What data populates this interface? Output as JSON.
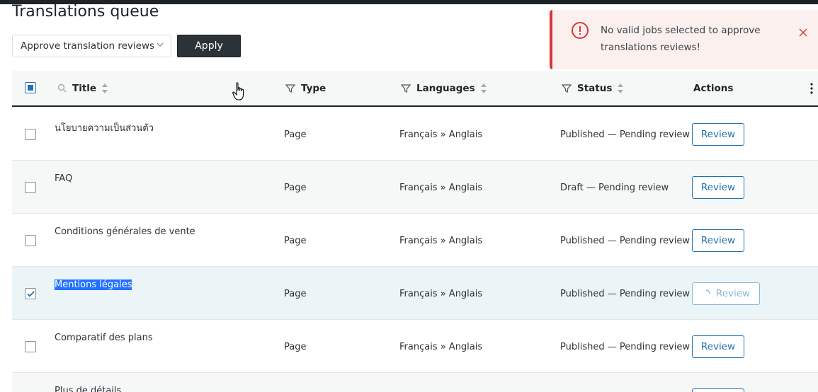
{
  "page": {
    "title": "Translations queue"
  },
  "bulk": {
    "selected": "Approve translation reviews",
    "apply_label": "Apply"
  },
  "notice": {
    "message": "No valid jobs selected to approve translations reviews!"
  },
  "table": {
    "headers": {
      "title": "Title",
      "type": "Type",
      "languages": "Languages",
      "status": "Status",
      "actions": "Actions"
    },
    "rows": [
      {
        "title": "นโยบายความเป็นส่วนตัว",
        "type": "Page",
        "languages": "Français » Anglais",
        "status": "Published — Pending review",
        "action": "Review",
        "checked": false
      },
      {
        "title": "FAQ",
        "type": "Page",
        "languages": "Français » Anglais",
        "status": "Draft — Pending review",
        "action": "Review",
        "checked": false
      },
      {
        "title": "Conditions générales de vente",
        "type": "Page",
        "languages": "Français » Anglais",
        "status": "Published — Pending review",
        "action": "Review",
        "checked": false
      },
      {
        "title": "Mentions légales",
        "type": "Page",
        "languages": "Français » Anglais",
        "status": "Published — Pending review",
        "action": "Review",
        "checked": true
      },
      {
        "title": "Comparatif des plans",
        "type": "Page",
        "languages": "Français » Anglais",
        "status": "Published — Pending review",
        "action": "Review",
        "checked": false
      },
      {
        "title": "Plus de détails",
        "type": "",
        "languages": "",
        "status": "",
        "action": "",
        "checked": false
      }
    ]
  },
  "colors": {
    "accent": "#2271b1",
    "error": "#d63638",
    "dark_button": "#2c3338",
    "highlight": "#2271ff"
  }
}
